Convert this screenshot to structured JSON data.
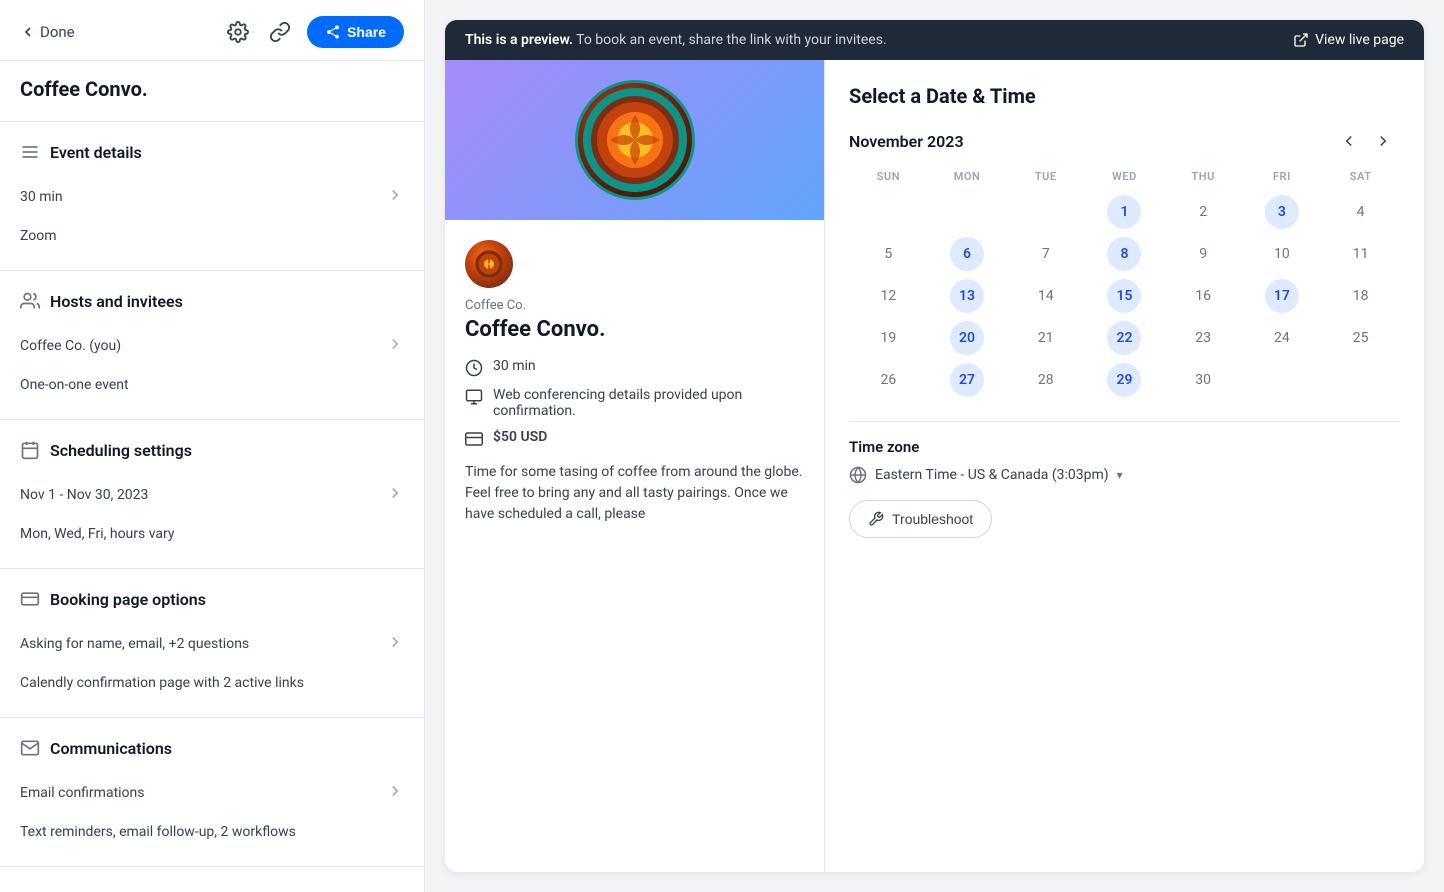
{
  "sidebar": {
    "done_label": "Done",
    "page_title": "Coffee Convo.",
    "share_label": "Share",
    "sections": [
      {
        "id": "event-details",
        "title": "Event details",
        "rows": [
          {
            "text": "30 min"
          },
          {
            "text": "Zoom"
          }
        ],
        "has_chevron": true
      },
      {
        "id": "hosts-invitees",
        "title": "Hosts and invitees",
        "rows": [
          {
            "text": "Coffee Co. (you)"
          },
          {
            "text": "One-on-one event"
          }
        ],
        "has_chevron": true
      },
      {
        "id": "scheduling",
        "title": "Scheduling settings",
        "rows": [
          {
            "text": "Nov 1 - Nov 30, 2023"
          },
          {
            "text": "Mon, Wed, Fri, hours vary"
          }
        ],
        "has_chevron": true
      },
      {
        "id": "booking",
        "title": "Booking page options",
        "rows": [
          {
            "text": "Asking for name, email, +2 questions"
          },
          {
            "text": "Calendly confirmation page with 2 active links"
          }
        ],
        "has_chevron": true
      },
      {
        "id": "communications",
        "title": "Communications",
        "rows": [
          {
            "text": "Email confirmations"
          },
          {
            "text": "Text reminders, email follow-up, 2 workflows"
          }
        ],
        "has_chevron": true
      }
    ]
  },
  "preview": {
    "banner": {
      "prefix": "This is a preview.",
      "message": " To book an event, share the link with your invitees.",
      "view_live_label": "View live page"
    },
    "event": {
      "organizer": "Coffee Co.",
      "name": "Coffee Convo.",
      "duration": "30 min",
      "conferencing": "Web conferencing details provided upon confirmation.",
      "price": "$50 USD",
      "description": "Time for some tasing of coffee from around the globe. Feel free to bring any and all tasty pairings. Once we have scheduled a call, please"
    },
    "calendar": {
      "title": "Select a Date & Time",
      "month": "November 2023",
      "days_header": [
        "SUN",
        "MON",
        "TUE",
        "WED",
        "THU",
        "FRI",
        "SAT"
      ],
      "weeks": [
        [
          null,
          null,
          null,
          "1",
          "2",
          "3",
          "4"
        ],
        [
          "5",
          "6",
          "7",
          "8",
          "9",
          "10",
          "11"
        ],
        [
          "12",
          "13",
          "14",
          "15",
          "16",
          "17",
          "18"
        ],
        [
          "19",
          "20",
          "21",
          "22",
          "23",
          "24",
          "25"
        ],
        [
          "26",
          "27",
          "28",
          "29",
          "30",
          null,
          null
        ]
      ],
      "available_days": [
        "1",
        "3",
        "6",
        "8",
        "13",
        "15",
        "17",
        "20",
        "22",
        "27",
        "29"
      ],
      "timezone_label": "Time zone",
      "timezone_value": "Eastern Time - US & Canada (3:03pm)",
      "troubleshoot_label": "Troubleshoot"
    }
  }
}
